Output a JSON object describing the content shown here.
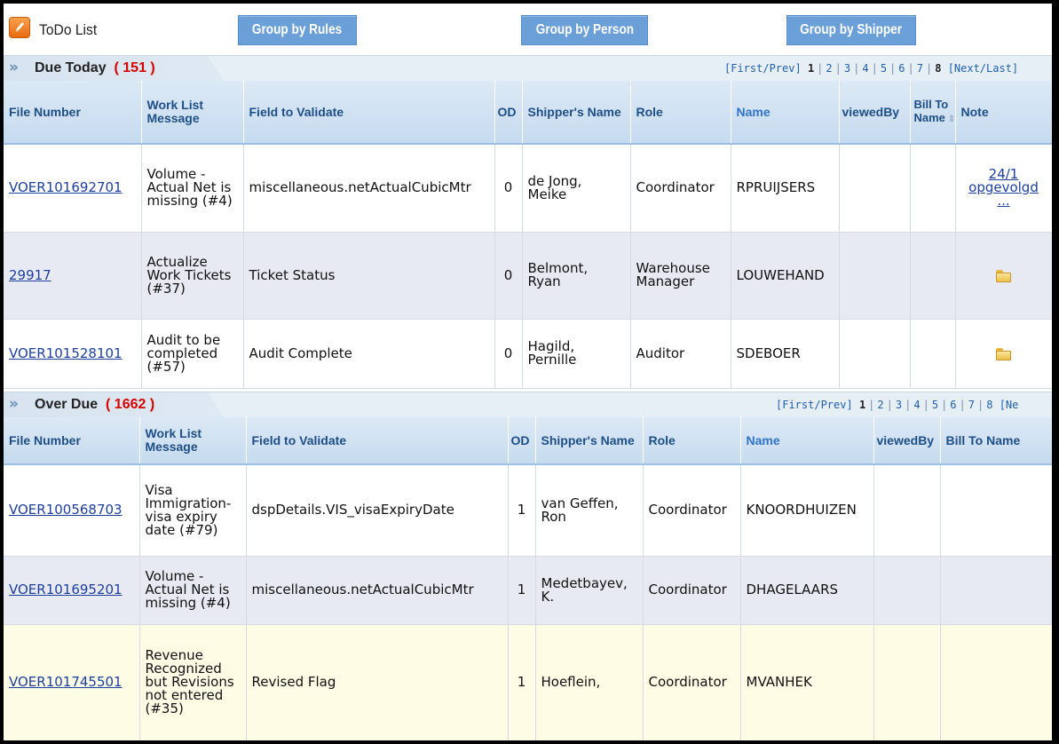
{
  "header": {
    "title": "ToDo List",
    "app_icon": "pencil-icon",
    "buttons": [
      "Group by Rules",
      "Group by Person",
      "Group by Shipper"
    ]
  },
  "due_today": {
    "title": "Due Today",
    "count": "( 151 )",
    "pager": {
      "first_prev": "[First/Prev]",
      "pages": [
        "1",
        "2",
        "3",
        "4",
        "5",
        "6",
        "7",
        "8"
      ],
      "current": "1",
      "next_last": "[Next/Last]"
    },
    "columns": [
      "File Number",
      "Work List Message",
      "Field to Validate",
      "OD",
      "Shipper's Name",
      "Role",
      "Name",
      "viewedBy",
      "Bill To Name",
      "Note"
    ],
    "rows": [
      {
        "file": "VOER101692701",
        "message": "Volume - Actual Net is missing (#4)",
        "field": "miscellaneous.netActualCubicMtr",
        "od": "0",
        "shipper": "de Jong, Meike",
        "role": "Coordinator",
        "name": "RPRUIJSERS",
        "viewed": "",
        "bill": "",
        "note": "24/1 opgevolgd ..."
      },
      {
        "file": "29917",
        "message": "Actualize Work Tickets (#37)",
        "field": "Ticket Status",
        "od": "0",
        "shipper": "Belmont, Ryan",
        "role": "Warehouse Manager",
        "name": "LOUWEHAND",
        "viewed": "",
        "bill": "",
        "note": ""
      },
      {
        "file": "VOER101528101",
        "message": "Audit to be completed (#57)",
        "field": "Audit Complete",
        "od": "0",
        "shipper": "Hagild, Pernille",
        "role": "Auditor",
        "name": "SDEBOER",
        "viewed": "",
        "bill": "",
        "note": ""
      }
    ]
  },
  "over_due": {
    "title": "Over Due",
    "count": "( 1662 )",
    "pager": {
      "first_prev": "[First/Prev]",
      "pages": [
        "1",
        "2",
        "3",
        "4",
        "5",
        "6",
        "7",
        "8"
      ],
      "current": "1",
      "next_last": "[Ne"
    },
    "columns": [
      "File Number",
      "Work List Message",
      "Field to Validate",
      "OD",
      "Shipper's Name",
      "Role",
      "Name",
      "viewedBy",
      "Bill To Name"
    ],
    "rows": [
      {
        "file": "VOER100568703",
        "message": "Visa Immigration-visa expiry date (#79)",
        "field": "dspDetails.VIS_visaExpiryDate",
        "od": "1",
        "shipper": "van Geffen, Ron",
        "role": "Coordinator",
        "name": "KNOORDHUIZEN",
        "viewed": "",
        "bill": ""
      },
      {
        "file": "VOER101695201",
        "message": "Volume - Actual Net is missing (#4)",
        "field": "miscellaneous.netActualCubicMtr",
        "od": "1",
        "shipper": "Medetbayev, K.",
        "role": "Coordinator",
        "name": "DHAGELAARS",
        "viewed": "",
        "bill": ""
      },
      {
        "file": "VOER101745501",
        "message": "Revenue Recognized but Revisions not entered (#35)",
        "field": "Revised Flag",
        "od": "1",
        "shipper": "Hoeflein,",
        "role": "Coordinator",
        "name": "MVANHEK",
        "viewed": "",
        "bill": ""
      }
    ]
  },
  "colors": {
    "button_bg": "#6a9fd8",
    "header_text": "#1d4f86",
    "count_red": "#d40000",
    "row_alt": "#e7e9f3",
    "row_highlight": "#fdfde6",
    "link": "#1e3f9c"
  }
}
